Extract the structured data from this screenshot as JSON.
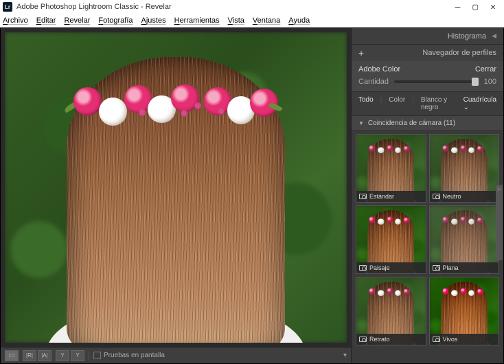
{
  "window": {
    "title": "Adobe Photoshop Lightroom Classic - Revelar",
    "logo_text": "Lr"
  },
  "menu": [
    "Archivo",
    "Editar",
    "Revelar",
    "Fotografía",
    "Ajustes",
    "Herramientas",
    "Vista",
    "Ventana",
    "Ayuda"
  ],
  "toolbar": {
    "proof_label": "Pruebas en pantalla"
  },
  "right_panel": {
    "histogram_label": "Histograma",
    "profile_browser_label": "Navegador de perfiles",
    "current_profile": "Adobe Color",
    "close_label": "Cerrar",
    "amount_label": "Cantidad",
    "amount_value": "100",
    "filters": {
      "all": "Todo",
      "color": "Color",
      "bw": "Blanco y negro",
      "grid": "Cuadrícula"
    },
    "section_label": "Coincidencia de cámara (11)",
    "thumbs": [
      {
        "label": "Estándar"
      },
      {
        "label": "Neutro"
      },
      {
        "label": "Paisaje"
      },
      {
        "label": "Plana"
      },
      {
        "label": "Retrato"
      },
      {
        "label": "Vivos"
      }
    ]
  }
}
